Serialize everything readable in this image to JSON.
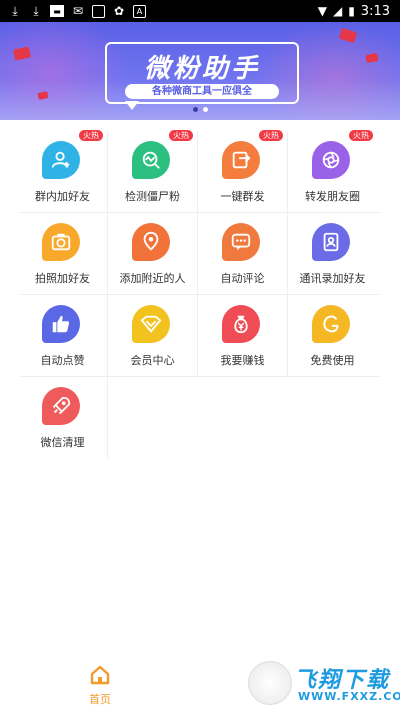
{
  "status_bar": {
    "time": "3:13"
  },
  "banner": {
    "title": "微粉助手",
    "subtitle": "各种微商工具一应俱全",
    "page_dots": 2,
    "active_dot": 0
  },
  "features": [
    {
      "label": "群内加好友",
      "hot": "火热",
      "icon": "add-friend-icon",
      "color": "#2fb3e6"
    },
    {
      "label": "检测僵尸粉",
      "hot": "火热",
      "icon": "detect-icon",
      "color": "#2bbf80"
    },
    {
      "label": "一键群发",
      "hot": "火热",
      "icon": "send-icon",
      "color": "#f47c3c"
    },
    {
      "label": "转发朋友圈",
      "hot": "火热",
      "icon": "moments-icon",
      "color": "#9a62e8"
    },
    {
      "label": "拍照加好友",
      "hot": "",
      "icon": "camera-icon",
      "color": "#f8a92c"
    },
    {
      "label": "添加附近的人",
      "hot": "",
      "icon": "location-icon",
      "color": "#f2733a"
    },
    {
      "label": "自动评论",
      "hot": "",
      "icon": "comment-icon",
      "color": "#f07a3e"
    },
    {
      "label": "通讯录加好友",
      "hot": "",
      "icon": "contacts-icon",
      "color": "#6b6be8"
    },
    {
      "label": "自动点赞",
      "hot": "",
      "icon": "thumbs-up-icon",
      "color": "#5b68e6"
    },
    {
      "label": "会员中心",
      "hot": "",
      "icon": "vip-icon",
      "color": "#f2c21e"
    },
    {
      "label": "我要赚钱",
      "hot": "",
      "icon": "money-icon",
      "color": "#ef4c55"
    },
    {
      "label": "免费使用",
      "hot": "",
      "icon": "free-icon",
      "color": "#f5b723"
    },
    {
      "label": "微信清理",
      "hot": "",
      "icon": "rocket-icon",
      "color": "#ef5a5a"
    }
  ],
  "tabbar": {
    "home_label": "首页",
    "accent": "#f29a2e"
  },
  "watermark": {
    "text": "飞翔下载",
    "url": "WWW.FXXZ.COM"
  }
}
